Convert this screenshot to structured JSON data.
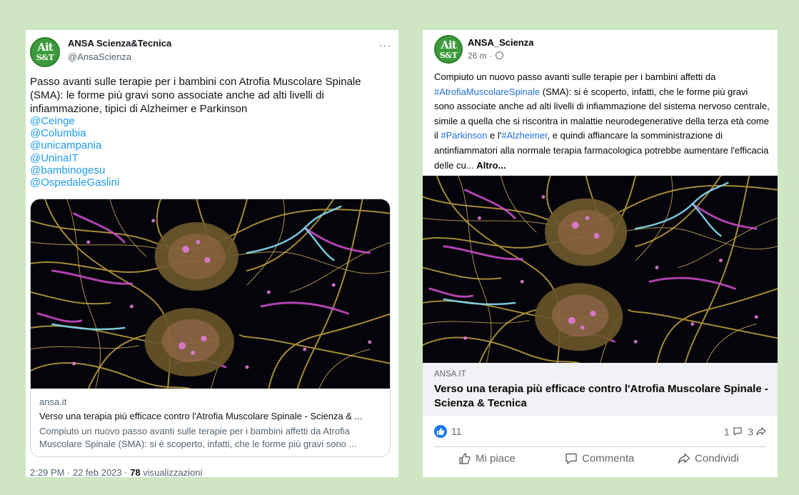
{
  "twitter": {
    "avatar_top": "Ait",
    "avatar_bottom": "S&T",
    "name": "ANSA Scienza&Tecnica",
    "handle": "@AnsaScienza",
    "more": "···",
    "text": "Passo avanti sulle terapie per i bambini con Atrofia Muscolare Spinale (SMA): le forme più gravi sono associate anche ad alti livelli di infiammazione, tipici di Alzheimer e Parkinson",
    "mentions": [
      "@Ceinge",
      "@Columbia",
      "@unicampania",
      "@UninaIT",
      "@bambinogesu",
      "@OspedaleGaslini"
    ],
    "card": {
      "domain": "ansa.it",
      "title": "Verso una terapia più efficace contro l'Atrofia Muscolare Spinale - Scienza & ...",
      "description": "Compiuto un nuovo passo avanti sulle terapie per i bambini affetti da Atrofia Muscolare Spinale (SMA): si è scoperto, infatti, che le forme più gravi sono ..."
    },
    "meta_time": "2:29 PM · 22 feb 2023 · ",
    "views_count": "78",
    "views_label": " visualizzazioni"
  },
  "facebook": {
    "avatar_top": "Ait",
    "avatar_bottom": "S&T",
    "name": "ANSA_Scienza",
    "time": "26 m ·",
    "text_1": "Compiuto un nuovo passo avanti sulle terapie per i bambini affetti da ",
    "tag_1": "#AtrofiaMuscolareSpinale",
    "text_2": " (SMA): si è scoperto, infatti, che le forme più gravi sono associate anche ad alti livelli di infiammazione del sistema nervoso centrale, simile a quella che si riscontra in malattie neurodegenerative della terza età come il ",
    "tag_2": "#Parkinson",
    "text_3": " e l'",
    "tag_3": "#Alzheimer",
    "text_4": ", e quindi affiancare la somministrazione di antinfiammatori alla normale terapia farmacologica potrebbe aumentare l'efficacia delle cu... ",
    "more_label": "Altro...",
    "link_domain": "ANSA.IT",
    "link_title": "Verso una terapia più efficace contro l'Atrofia Muscolare Spinale - Scienza & Tecnica",
    "reactions_count": "11",
    "comments_count": "1",
    "shares_count": "3",
    "actions": {
      "like": "Mi piace",
      "comment": "Commenta",
      "share": "Condividi"
    }
  },
  "colors": {
    "background": "#cfe6c2",
    "twitter_link": "#1d9bf0",
    "facebook_link": "#216fdb",
    "facebook_blue": "#1877f2",
    "avatar_green": "#3c9a3c"
  }
}
